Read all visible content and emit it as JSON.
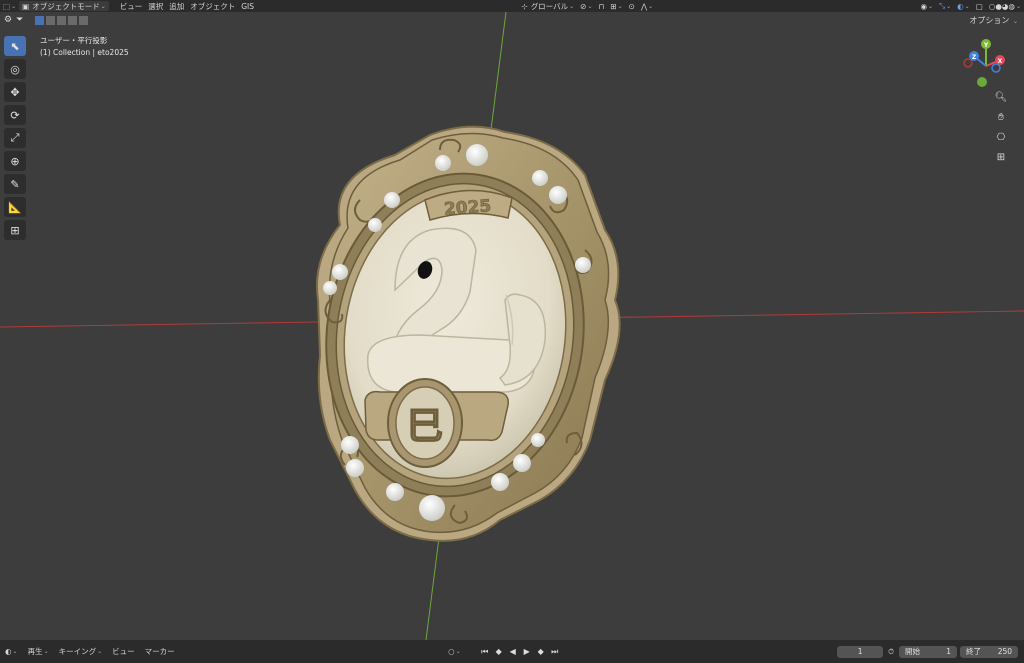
{
  "header": {
    "mode_label": "オブジェクトモード",
    "menus": [
      "ビュー",
      "選択",
      "追加",
      "オブジェクト",
      "GIS"
    ],
    "transform_orientation": "グローバル",
    "options_label": "オプション"
  },
  "viewport": {
    "view_name": "ユーザー・平行投影",
    "collection_info": "(1) Collection | eto2025"
  },
  "model": {
    "year_text": "2025",
    "kanji": "巳"
  },
  "gizmo": {
    "axes": [
      "X",
      "Y",
      "Z"
    ],
    "colors": {
      "x": "#e8475a",
      "y": "#7fba34",
      "z": "#3f82e0"
    }
  },
  "timeline": {
    "playback_label": "再生",
    "keying_label": "キーイング",
    "view_label": "ビュー",
    "marker_label": "マーカー",
    "current_frame": "1",
    "start_label": "開始",
    "start_frame": "1",
    "end_label": "終了",
    "end_frame": "250"
  },
  "colors": {
    "viewport_bg": "#3d3d3d",
    "header_bg": "#2b2b2b",
    "active_tool": "#4772b3",
    "frame_gold": "#a89670",
    "relief_ivory": "#e6e1cf"
  }
}
